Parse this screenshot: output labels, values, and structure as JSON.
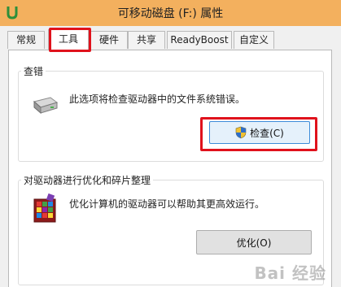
{
  "window": {
    "title": "可移动磁盘 (F:) 属性"
  },
  "tabs": [
    {
      "label": "常规",
      "active": false
    },
    {
      "label": "工具",
      "active": true
    },
    {
      "label": "硬件",
      "active": false
    },
    {
      "label": "共享",
      "active": false
    },
    {
      "label": "ReadyBoost",
      "active": false
    },
    {
      "label": "自定义",
      "active": false
    }
  ],
  "error_check": {
    "title": "查错",
    "description": "此选项将检查驱动器中的文件系统错误。",
    "button_label": "检查(C)",
    "icon": "drive-icon",
    "button_icon": "uac-shield-icon"
  },
  "optimize": {
    "title": "对驱动器进行优化和碎片整理",
    "description": "优化计算机的驱动器可以帮助其更高效运行。",
    "button_label": "优化(O)",
    "icon": "defrag-icon"
  },
  "colors": {
    "title_bar": "#f3b05e",
    "highlight": "#e0121c",
    "focus_border": "#3c8bd9"
  },
  "watermark": "Bai 经验"
}
